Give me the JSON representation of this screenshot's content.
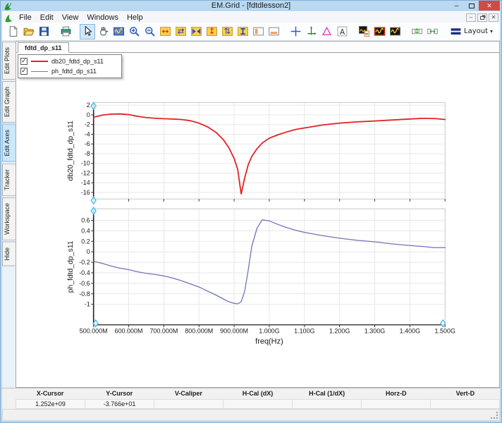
{
  "window": {
    "title": "EM.Grid - [fdtdlesson2]",
    "controls": {
      "minimize": "–",
      "maximize": "□",
      "close": "✕"
    }
  },
  "menus": [
    "File",
    "Edit",
    "View",
    "Windows",
    "Help"
  ],
  "mdi": {
    "minimize": "–",
    "close": "✕"
  },
  "toolbar": {
    "layout_label": "Layout",
    "caret": "▾",
    "items": [
      {
        "name": "new"
      },
      {
        "name": "open"
      },
      {
        "name": "save"
      },
      {
        "name": "print",
        "sep": true
      },
      {
        "name": "select",
        "sep": true,
        "selected": true
      },
      {
        "name": "pan"
      },
      {
        "name": "zoom-window"
      },
      {
        "name": "zoom-in"
      },
      {
        "name": "zoom-out"
      },
      {
        "name": "expand-h",
        "glyph": "↔",
        "glyph_color": "#d41c1c"
      },
      {
        "name": "shrink-h",
        "glyph": "⇄",
        "glyph_color": "#2038c8"
      },
      {
        "name": "fit-h"
      },
      {
        "name": "expand-v",
        "glyph": "↕",
        "glyph_color": "#d41c1c"
      },
      {
        "name": "shrink-v",
        "glyph": "⇅",
        "glyph_color": "#2038c8"
      },
      {
        "name": "fit-v"
      },
      {
        "name": "split-left"
      },
      {
        "name": "split-bottom"
      },
      {
        "name": "crosshair",
        "sep": true
      },
      {
        "name": "axes"
      },
      {
        "name": "delta-marker",
        "glyph": "△",
        "glyph_color": "#e040c0"
      },
      {
        "name": "text-label",
        "glyph": "A",
        "glyph_color": "#333333"
      },
      {
        "name": "plot-copy",
        "sep": true
      },
      {
        "name": "plot-frame-red"
      },
      {
        "name": "plot-frame"
      },
      {
        "name": "align-v",
        "sep": true,
        "glyph": "↕",
        "glyph_color": "#18a018"
      },
      {
        "name": "align-h",
        "glyph": "↔",
        "glyph_color": "#18a018"
      },
      {
        "name": "layout-menu",
        "sep": true
      }
    ]
  },
  "sidebar": {
    "tabs": [
      {
        "label": "Edit Plots",
        "selected": false
      },
      {
        "label": "Edit Graph",
        "selected": false
      },
      {
        "label": "Edit Axes",
        "selected": true
      },
      {
        "label": "Tracker",
        "selected": false
      },
      {
        "label": "Workspace",
        "selected": false
      },
      {
        "label": "Hide",
        "selected": false
      }
    ]
  },
  "doc_tab": {
    "label": "fdtd_dp_s11"
  },
  "legend": {
    "items": [
      {
        "label": "db20_fdtd_dp_s11",
        "color": "#e32222",
        "checked": true,
        "thickness": 2
      },
      {
        "label": "ph_fdtd_dp_s11",
        "color": "#7173b8",
        "checked": true,
        "thickness": 1
      }
    ]
  },
  "status": {
    "cols": [
      {
        "label": "X-Cursor",
        "value": "1.252e+09"
      },
      {
        "label": "Y-Cursor",
        "value": "-3.766e+01"
      },
      {
        "label": "V-Caliper",
        "value": ""
      },
      {
        "label": "H-Cal (dX)",
        "value": ""
      },
      {
        "label": "H-Cal (1/dX)",
        "value": ""
      },
      {
        "label": "Horz-D",
        "value": ""
      },
      {
        "label": "Vert-D",
        "value": ""
      }
    ]
  },
  "chart_data": {
    "type": "line",
    "xlabel": "freq(Hz)",
    "x_unit": "MHz",
    "xlim_mhz": [
      500,
      1500
    ],
    "x_ticks_mhz": [
      500,
      600,
      700,
      800,
      900,
      1000,
      1100,
      1200,
      1300,
      1400,
      1500
    ],
    "x_tick_labels": [
      "500.000M",
      "600.000M",
      "700.000M",
      "800.000M",
      "900.000M",
      "1.000G",
      "1.100G",
      "1.200G",
      "1.300G",
      "1.400G",
      "1.500G"
    ],
    "x_mhz": [
      500,
      525,
      550,
      575,
      600,
      625,
      650,
      675,
      700,
      725,
      750,
      775,
      800,
      825,
      850,
      870,
      885,
      900,
      910,
      920,
      930,
      940,
      950,
      965,
      980,
      1000,
      1025,
      1050,
      1075,
      1100,
      1150,
      1200,
      1250,
      1300,
      1350,
      1400,
      1440,
      1470,
      1500
    ],
    "series": [
      {
        "name": "db20_fdtd_dp_s11",
        "color": "#e32222",
        "plot": "top",
        "values": [
          -0.5,
          -0.05,
          0.15,
          0.2,
          0.05,
          -0.3,
          -0.55,
          -0.7,
          -0.8,
          -0.85,
          -0.95,
          -1.2,
          -1.7,
          -2.5,
          -3.7,
          -5.2,
          -6.8,
          -9.0,
          -11.2,
          -16.3,
          -13.0,
          -10.3,
          -8.6,
          -7.0,
          -5.8,
          -4.8,
          -4.1,
          -3.5,
          -3.0,
          -2.7,
          -2.1,
          -1.7,
          -1.45,
          -1.25,
          -1.05,
          -0.85,
          -0.7,
          -0.75,
          -0.95
        ]
      },
      {
        "name": "ph_fdtd_dp_s11",
        "color": "#7173b8",
        "plot": "bottom",
        "values": [
          -0.18,
          -0.22,
          -0.27,
          -0.31,
          -0.34,
          -0.38,
          -0.41,
          -0.43,
          -0.46,
          -0.5,
          -0.55,
          -0.61,
          -0.67,
          -0.75,
          -0.83,
          -0.9,
          -0.95,
          -0.98,
          -0.99,
          -0.95,
          -0.75,
          -0.35,
          0.1,
          0.45,
          0.61,
          0.59,
          0.52,
          0.46,
          0.41,
          0.37,
          0.31,
          0.26,
          0.22,
          0.19,
          0.15,
          0.12,
          0.1,
          0.08,
          0.08
        ]
      }
    ],
    "top": {
      "ylabel": "db20_fdtd_dp_s11",
      "yticks": [
        2,
        0,
        -2,
        -4,
        -6,
        -8,
        -10,
        -12,
        -14,
        -16
      ],
      "ylim": [
        -17.35,
        2.55
      ],
      "grid": true
    },
    "bottom": {
      "ylabel": "ph_fdtd_dp_s11",
      "yticks": [
        0.6,
        0.4,
        0.2,
        0,
        -0.2,
        -0.4,
        -0.6,
        -0.8,
        -1
      ],
      "ylim": [
        -1.39,
        0.82
      ],
      "grid": true
    },
    "legend_position": "top-left"
  }
}
